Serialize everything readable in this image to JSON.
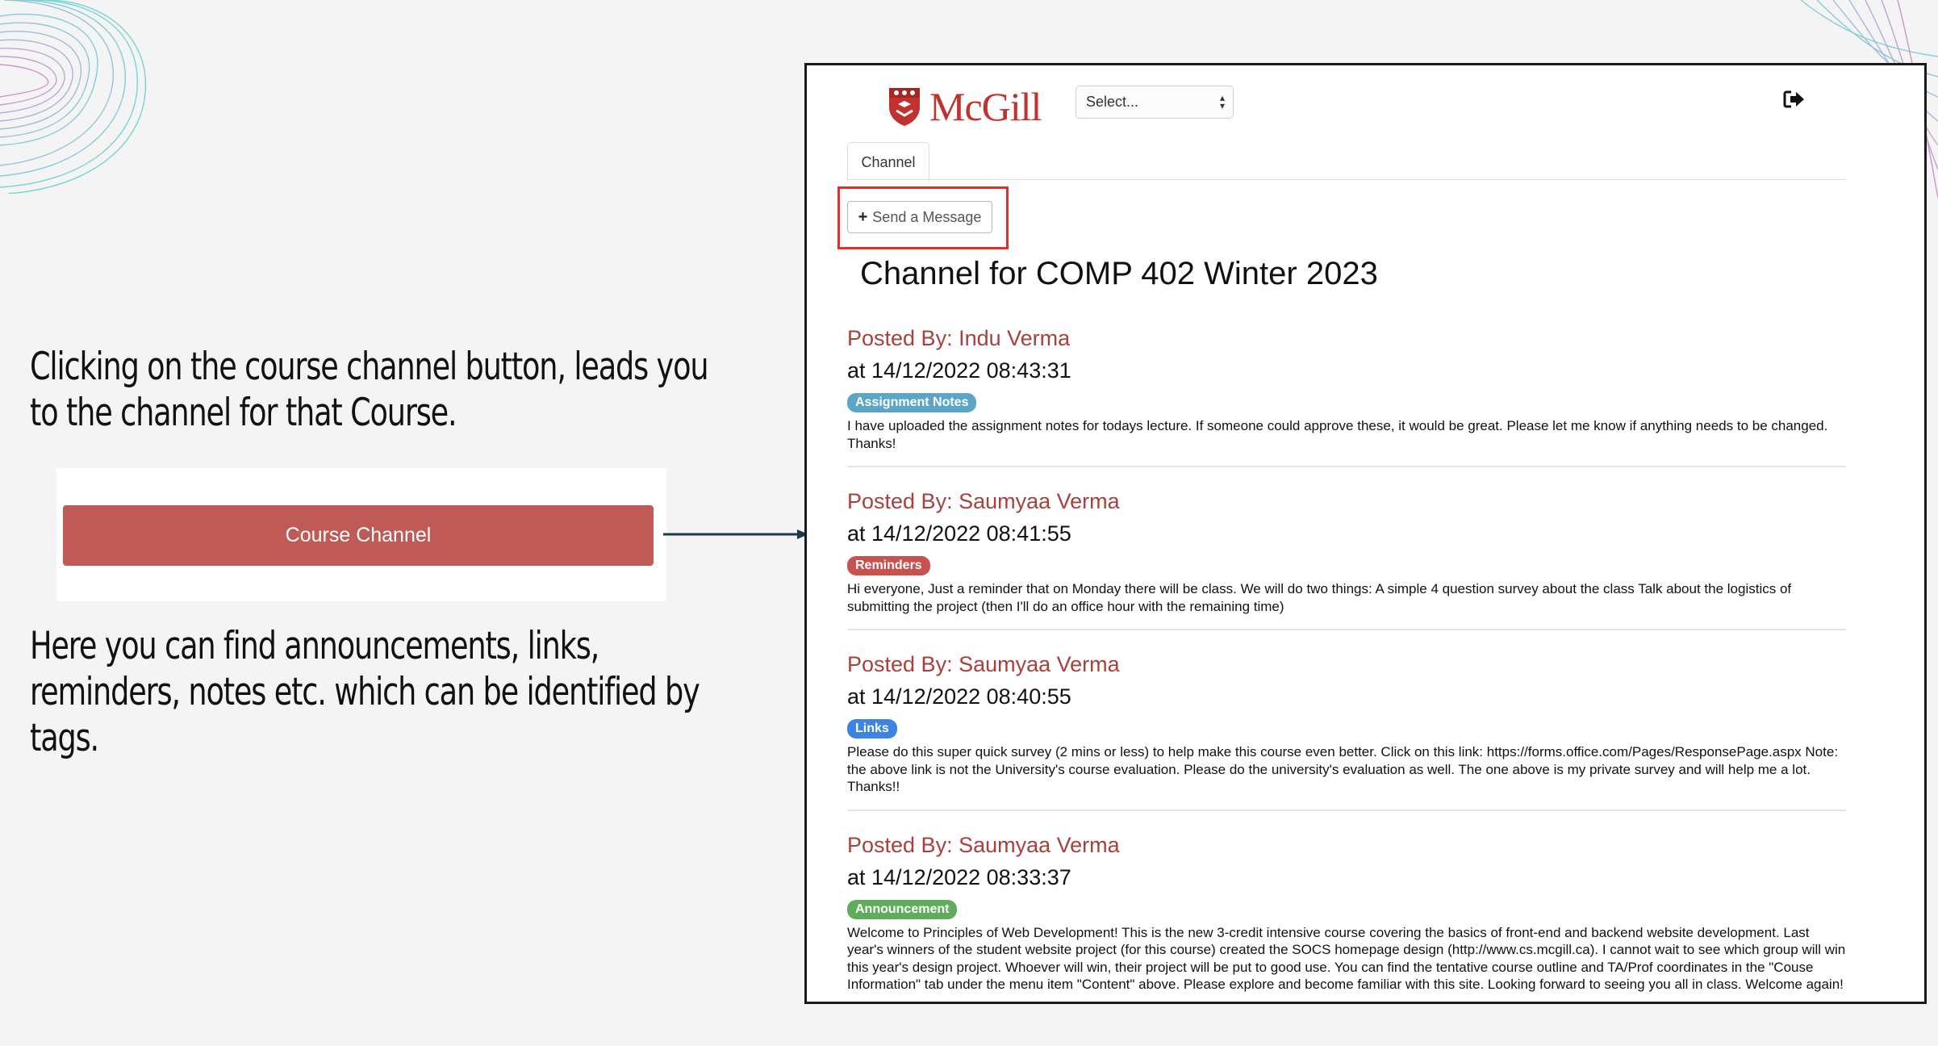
{
  "slide": {
    "caption_top": "Clicking on the course channel button, leads you to the channel for that Course.",
    "caption_bottom": "Here you can find announcements, links, reminders, notes etc. which can be identified by tags.",
    "course_button_label": "Course Channel"
  },
  "app": {
    "logo_text": "McGill",
    "select_value": "Select...",
    "tab_label": "Channel",
    "send_button_label": "Send a Message",
    "channel_title": "Channel for COMP 402 Winter 2023"
  },
  "posts": [
    {
      "author": "Posted By: Indu Verma",
      "date": "at 14/12/2022 08:43:31",
      "tag": "Assignment Notes",
      "tag_color": "#5ba6c6",
      "body": "I have uploaded the assignment notes for todays lecture. If someone could approve these, it would be great. Please let me know if anything needs to be changed. Thanks!"
    },
    {
      "author": "Posted By: Saumyaa Verma",
      "date": "at 14/12/2022 08:41:55",
      "tag": "Reminders",
      "tag_color": "#c7524f",
      "body": "Hi everyone, Just a reminder that on Monday there will be class. We will do two things: A simple 4 question survey about the class Talk about the logistics of submitting the project (then I'll do an office hour with the remaining time)"
    },
    {
      "author": "Posted By: Saumyaa Verma",
      "date": "at 14/12/2022 08:40:55",
      "tag": "Links",
      "tag_color": "#3d83e4",
      "body": "Please do this super quick survey (2 mins or less) to help make this course even better. Click on this link: https://forms.office.com/Pages/ResponsePage.aspx Note: the above link is not the University's course evaluation. Please do the university's evaluation as well. The one above is my private survey and will help me a lot. Thanks!!"
    },
    {
      "author": "Posted By: Saumyaa Verma",
      "date": "at 14/12/2022 08:33:37",
      "tag": "Announcement",
      "tag_color": "#5fac5c",
      "body": "Welcome to Principles of Web Development! This is the new 3-credit intensive course covering the basics of front-end and backend website development. Last year's winners of the student website project (for this course) created the SOCS homepage design (http://www.cs.mcgill.ca). I cannot wait to see which group will win this year's design project. Whoever will win, their project will be put to good use. You can find the tentative course outline and TA/Prof coordinates in the \"Couse Information\" tab under the menu item \"Content\" above. Please explore and become familiar with this site. Looking forward to seeing you all in class. Welcome again!"
    }
  ],
  "colors": {
    "mcgill_red": "#c1322e",
    "course_button": "#c05a56",
    "author_text": "#a8403b",
    "highlight_box": "#e0302c"
  },
  "icons": {
    "logo": "mcgill-shield-icon",
    "logout": "logout-icon",
    "send": "plus-icon",
    "select_caret": "updown-caret-icon"
  }
}
